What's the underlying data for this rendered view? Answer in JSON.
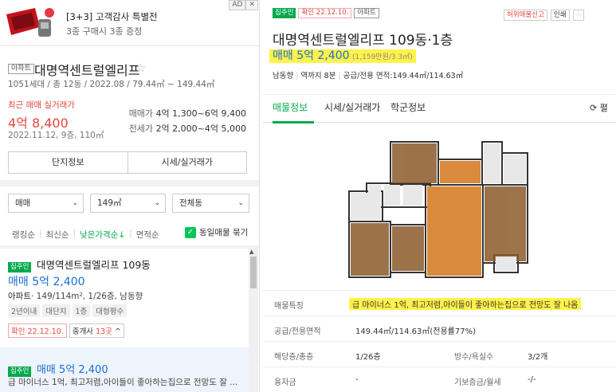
{
  "ad": {
    "title": "[3+3] 고객감사 특별전",
    "subtitle": "3종 구매시 3종 증정",
    "badge": "AD",
    "close": "✕"
  },
  "complex": {
    "type": "아파트",
    "name": "대명역센트럴엘리프",
    "star": "☆",
    "meta": "1051세대 / 총 12동 / 2022.08 / 79.44㎡ ~ 149.44㎡",
    "recent_label": "최근 매매 실거래가",
    "recent_price": "4억 8,400",
    "recent_date": "2022.11.12, 9층, 110㎡",
    "sale_label": "매매가",
    "sale_range": "4억 1,300~6억 9,400",
    "jeonse_label": "전세가",
    "jeonse_range": "2억 2,000~4억 5,000",
    "btn_info": "단지정보",
    "btn_price": "시세/실거래가"
  },
  "filters": {
    "trade": "매매",
    "area": "149㎡",
    "dong": "전체동",
    "chevron": "⌄"
  },
  "sorts": {
    "ranking": "랭킹순",
    "newest": "최신순",
    "low_price": "낮은가격순↓",
    "area": "면적순",
    "same_listing": "동일매물 묶기",
    "check": "✓",
    "divider": "|"
  },
  "listing1": {
    "tag": "집주인",
    "name": "대명역센트럴엘리프 109동",
    "price": "매매 5억 2,400",
    "type": "아파트",
    "info": "· 149/114m², 1/26층, 남동향",
    "chips": [
      "2년이내",
      "대단지",
      "1층",
      "대형평수"
    ],
    "confirmed": "확인 22.12.10.",
    "agents_label": "중개사 ",
    "agents_count": "13곳",
    "agents_arrow": " ^"
  },
  "listing2": {
    "tag": "집주인",
    "price": "매매 5억 2,400",
    "desc": "급 마이너스 1억, 최고저렴,아이들이 좋아하는집으로 전망도 잘 ..."
  },
  "detail": {
    "tag_owner": "집주인",
    "tag_confirmed": "확인 22.12.10.",
    "tag_type": "아파트",
    "report": "허위매물신고",
    "print": "인쇄",
    "star": "☆",
    "title": "대명역센트럴엘리프 109동·1층",
    "price": "매매 5억 2,400",
    "unit_price": "(1,159만원/3.3㎡)",
    "meta_direction": "남동향",
    "meta_station": "역까지 8분",
    "meta_area": "공급/전용 면적:149.44㎡/114.63㎡",
    "tabs": [
      "매물정보",
      "시세/실거래가",
      "학군정보"
    ],
    "refresh": "⟳ 펼",
    "rows": {
      "feature_label": "매물특징",
      "feature_value": "급 마이너스 1억, 최고저렴,아이들이 좋아하는집으로 전망도 잘 나옴",
      "area_label": "공급/전용면적",
      "area_value": "149.44㎡/114.63㎡(전용률77%)",
      "floor_label": "해당층/총층",
      "floor_value": "1/26층",
      "rooms_label": "방수/욕실수",
      "rooms_value": "3/2개",
      "loan_label": "융자금",
      "loan_value": "-",
      "deposit_label": "기보증금/월세",
      "deposit_value": "-/-"
    }
  }
}
